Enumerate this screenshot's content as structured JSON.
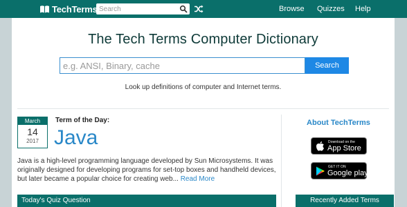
{
  "header": {
    "logo_text": "TechTerms",
    "search_placeholder": "Search",
    "nav": [
      "Browse",
      "Quizzes",
      "Help"
    ]
  },
  "hero": {
    "title": "The Tech Terms Computer Dictionary",
    "search_placeholder": "e.g. ANSI, Binary, cache",
    "search_button": "Search",
    "subtitle": "Look up definitions of computer and Internet terms."
  },
  "term_of_day": {
    "label": "Term of the Day:",
    "date": {
      "month": "March",
      "day": "14",
      "year": "2017"
    },
    "term": "Java",
    "description": "Java is a high-level programming language developed by Sun Microsystems. It was originally designed for developing programs for set-top boxes and handheld devices, but later became a popular choice for creating web...",
    "read_more": "Read More"
  },
  "quiz": {
    "title": "Today's Quiz Question"
  },
  "sidebar": {
    "about": "About TechTerms",
    "app_store": {
      "small": "Download on the",
      "big": "App Store"
    },
    "google_play": {
      "small": "GET IT ON",
      "big": "Google play"
    },
    "recent_title": "Recently Added Terms"
  },
  "colors": {
    "brand": "#0a6f6a",
    "link": "#2a88c8",
    "button": "#1e88e5"
  },
  "icons": [
    "book-icon",
    "search-icon",
    "shuffle-icon",
    "apple-icon",
    "google-play-icon"
  ]
}
